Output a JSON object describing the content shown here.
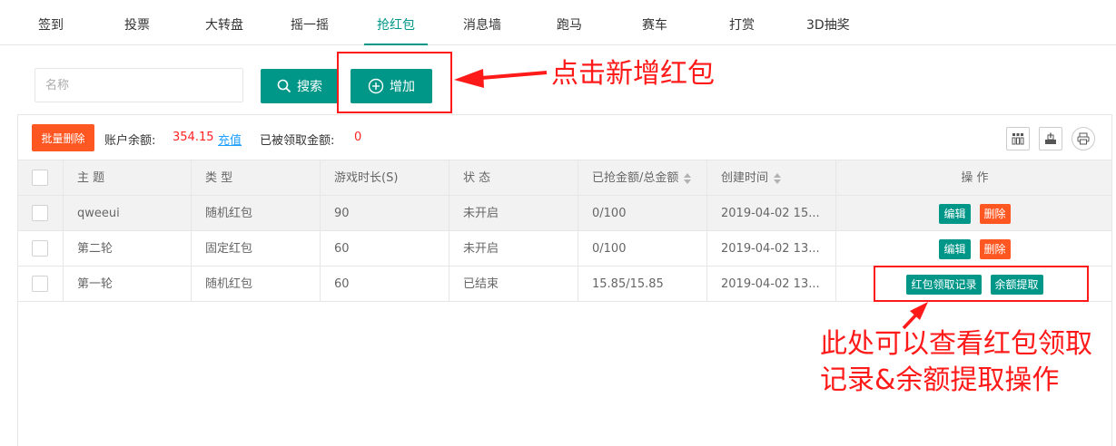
{
  "tabs": [
    "签到",
    "投票",
    "大转盘",
    "摇一摇",
    "抢红包",
    "消息墙",
    "跑马",
    "赛车",
    "打赏",
    "3D抽奖"
  ],
  "active_tab": "抢红包",
  "search": {
    "placeholder": "名称",
    "value": ""
  },
  "buttons": {
    "search": "搜索",
    "add": "增加",
    "batch_delete": "批量删除"
  },
  "toolbar": {
    "balance_label": "账户余额:",
    "balance_value": "354.15",
    "recharge": "充值",
    "claimed_label": "已被领取金额:",
    "claimed_value": "0"
  },
  "table": {
    "headers": [
      "主 题",
      "类 型",
      "游戏时长(S)",
      "状 态",
      "已抢金额/总金额",
      "创建时间",
      "操 作"
    ],
    "rows": [
      {
        "topic": "qweeui",
        "type": "随机红包",
        "duration": "90",
        "status": "未开启",
        "amount": "0/100",
        "created": "2019-04-02 15...",
        "ops": [
          "编辑",
          "删除"
        ]
      },
      {
        "topic": "第二轮",
        "type": "固定红包",
        "duration": "60",
        "status": "未开启",
        "amount": "0/100",
        "created": "2019-04-02 13...",
        "ops": [
          "编辑",
          "删除"
        ]
      },
      {
        "topic": "第一轮",
        "type": "随机红包",
        "duration": "60",
        "status": "已结束",
        "amount": "15.85/15.85",
        "created": "2019-04-02 13...",
        "ops": [
          "红包领取记录",
          "余额提取"
        ]
      }
    ]
  },
  "annotations": {
    "add_note": "点击新增红包",
    "ops_note_line1": "此处可以查看红包领取",
    "ops_note_line2": "记录&余额提取操作"
  },
  "icons": {
    "search": "search-icon",
    "add": "plus-circle-icon",
    "columns": "columns-filter-icon",
    "export": "export-icon",
    "print": "print-icon"
  },
  "colors": {
    "primary": "#009688",
    "danger": "#ff5722",
    "annotation": "#ff1a1a",
    "link": "#1e9fff"
  }
}
